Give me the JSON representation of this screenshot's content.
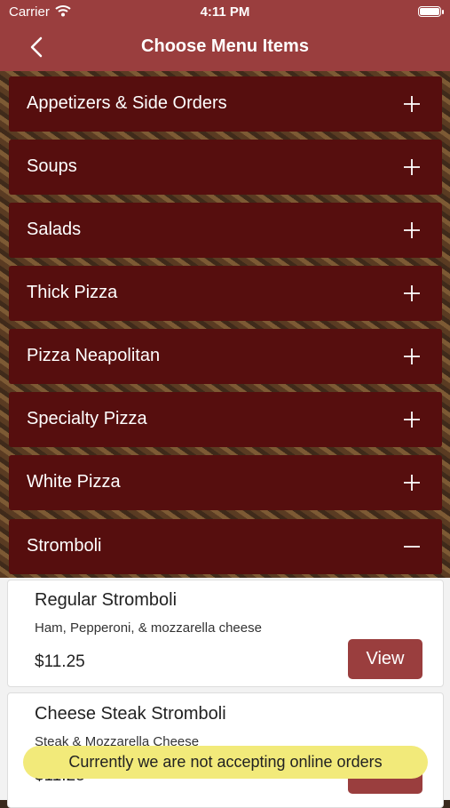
{
  "status_bar": {
    "carrier": "Carrier",
    "time": "4:11 PM"
  },
  "nav": {
    "title": "Choose Menu Items"
  },
  "categories": [
    {
      "label": "Appetizers & Side Orders",
      "icon": "plus-icon"
    },
    {
      "label": "Soups",
      "icon": "plus-icon"
    },
    {
      "label": "Salads",
      "icon": "plus-icon"
    },
    {
      "label": "Thick Pizza",
      "icon": "plus-icon"
    },
    {
      "label": "Pizza Neapolitan",
      "icon": "plus-icon"
    },
    {
      "label": "Specialty Pizza",
      "icon": "plus-icon"
    },
    {
      "label": "White Pizza",
      "icon": "plus-icon"
    },
    {
      "label": "Stromboli",
      "icon": "minus-icon"
    }
  ],
  "products": [
    {
      "name": "Regular Stromboli",
      "description": "Ham, Pepperoni, & mozzarella cheese",
      "price": "$11.25",
      "button": "View"
    },
    {
      "name": "Cheese Steak Stromboli",
      "description": "Steak & Mozzarella Cheese",
      "price": "$11.25",
      "button": "View"
    }
  ],
  "toast": "Currently we are not accepting online orders",
  "colors": {
    "brand": "#9a3e3e",
    "category_bg": "#560e0e",
    "toast_bg": "#f2ea7a"
  }
}
